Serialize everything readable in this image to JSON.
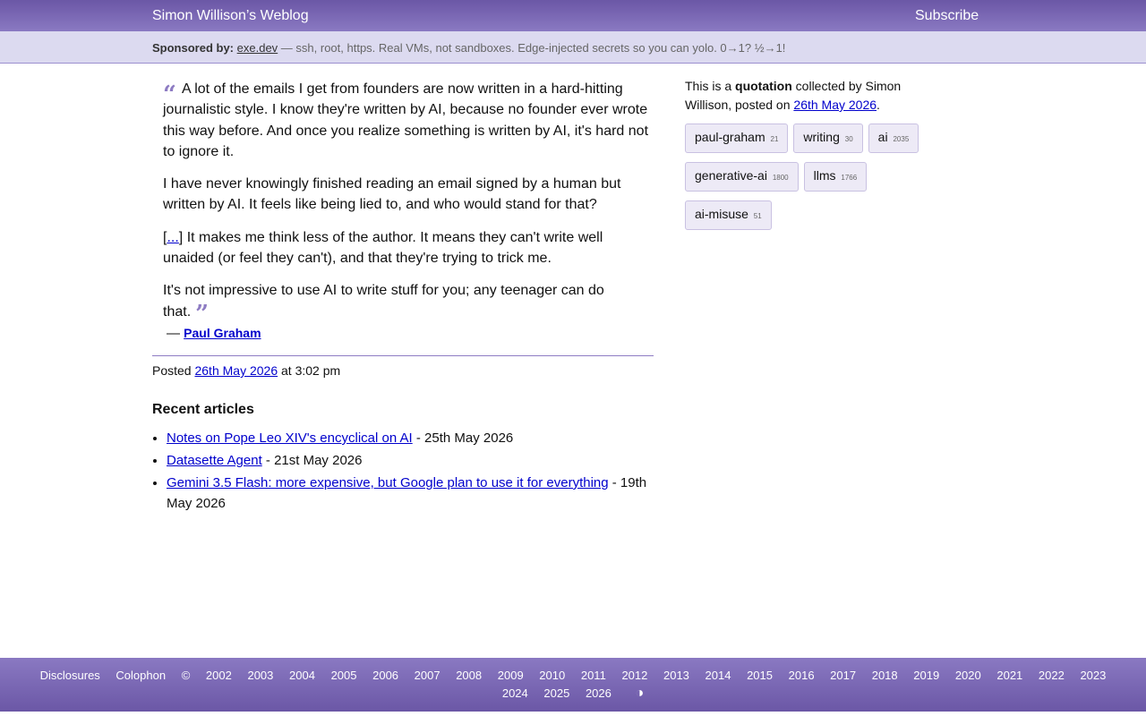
{
  "header": {
    "site_title": "Simon Willison’s Weblog",
    "subscribe": "Subscribe"
  },
  "sponsor": {
    "label": "Sponsored by:",
    "link_text": "exe.dev",
    "text": " — ssh, root, https. Real VMs, not sandboxes. Edge-injected secrets so you can yolo. 0→1? ½→1!"
  },
  "quote": {
    "open_mark": "“",
    "close_mark": "”",
    "p1": "A lot of the emails I get from founders are now written in a hard-hitting journalistic style. I know they're written by AI, because no founder ever wrote this way before. And once you realize something is written by AI, it's hard not to ignore it.",
    "p2": "I have never knowingly finished reading an email signed by a human but written by AI. It feels like being lied to, and who would stand for that?",
    "p3_link": "...",
    "p3_text": "] It makes me think less of the author. It means they can't write well unaided (or feel they can't), and that they're trying to trick me.",
    "p3_open": "[",
    "p4": "It's not impressive to use AI to write stuff for you; any teenager can do that.",
    "cite_dash": "— ",
    "cite_author": "Paul Graham"
  },
  "posted": {
    "prefix": "Posted ",
    "date": "26th May 2026",
    "suffix": " at 3:02 pm"
  },
  "recent": {
    "heading": "Recent articles",
    "items": [
      {
        "title": "Notes on Pope Leo XIV's encyclical on AI",
        "date": " - 25th May 2026"
      },
      {
        "title": "Datasette Agent",
        "date": " - 21st May 2026"
      },
      {
        "title": "Gemini 3.5 Flash: more expensive, but Google plan to use it for everything",
        "date": " - 19th May 2026"
      }
    ]
  },
  "sidebar": {
    "intro_1": "This is a ",
    "intro_bold": "quotation",
    "intro_2": " collected by Simon Willison, posted on ",
    "intro_date": "26th May 2026",
    "intro_end": ".",
    "tags": [
      {
        "name": "paul-graham",
        "count": "21"
      },
      {
        "name": "writing",
        "count": "30"
      },
      {
        "name": "ai",
        "count": "2035"
      },
      {
        "name": "generative-ai",
        "count": "1800"
      },
      {
        "name": "llms",
        "count": "1766"
      },
      {
        "name": "ai-misuse",
        "count": "51"
      }
    ]
  },
  "footer": {
    "disclosures": "Disclosures",
    "colophon": "Colophon",
    "copyright": "©",
    "years": [
      "2002",
      "2003",
      "2004",
      "2005",
      "2006",
      "2007",
      "2008",
      "2009",
      "2010",
      "2011",
      "2012",
      "2013",
      "2014",
      "2015",
      "2016",
      "2017",
      "2018",
      "2019",
      "2020",
      "2021",
      "2022",
      "2023",
      "2024",
      "2025",
      "2026"
    ],
    "contrast_icon": "contrast-icon",
    "contrast_glyph": "◑"
  }
}
